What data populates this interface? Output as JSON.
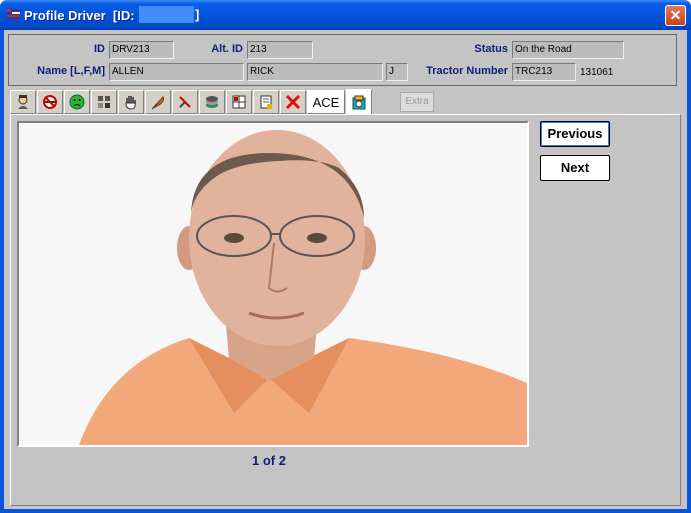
{
  "window": {
    "title": "Profile Driver",
    "id_prefix": "[ID:",
    "id_suffix": "]"
  },
  "header": {
    "id_label": "ID",
    "id_value": "DRV213",
    "alt_id_label": "Alt. ID",
    "alt_id_value": "213",
    "status_label": "Status",
    "status_value": "On the Road",
    "name_label": "Name [L,F,M]",
    "last_name": "ALLEN",
    "first_name": "RICK",
    "middle_initial": "J",
    "tractor_label": "Tractor Number",
    "tractor_value": "TRC213",
    "tractor_extra": "131061"
  },
  "tabs": {
    "ace_label": "ACE",
    "extra_label": "Extra",
    "icons": [
      "driver-icon",
      "no-smoking-icon",
      "face-icon",
      "group-icon",
      "hand-icon",
      "feather-icon",
      "tools-icon",
      "stack-icon",
      "grid-icon",
      "note-icon",
      "delete-icon",
      "ace-icon",
      "photo-icon"
    ]
  },
  "photo": {
    "previous_label": "Previous",
    "next_label": "Next",
    "pager": "1 of 2"
  }
}
